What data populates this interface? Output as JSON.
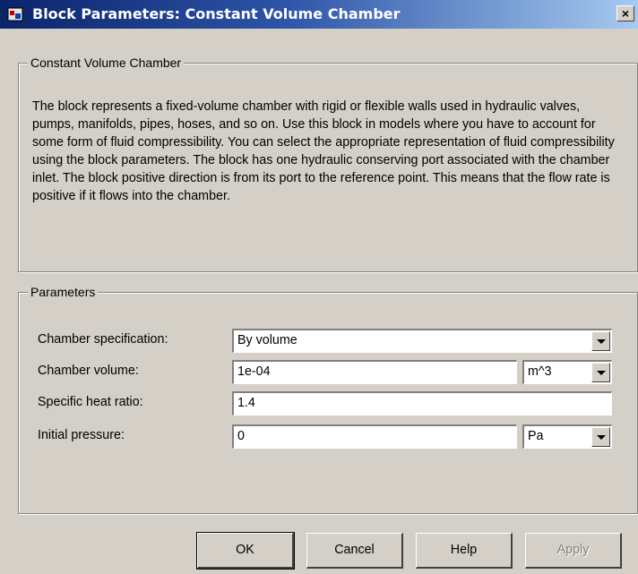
{
  "window": {
    "title": "Block Parameters: Constant Volume Chamber",
    "close_glyph": "×",
    "icon": "block-parameters-icon"
  },
  "description_group": {
    "title": "Constant Volume Chamber",
    "text": "The block represents a fixed-volume chamber with rigid or flexible walls used in hydraulic valves, pumps, manifolds, pipes, hoses, and so on. Use this block in models where you have to account for some form of fluid compressibility. You can select the appropriate representation of fluid compressibility using the block parameters. The block has one hydraulic conserving port associated with the chamber inlet. The block positive direction is from its port to the reference point. This means that the flow rate is positive if it flows into the chamber."
  },
  "parameters_group": {
    "title": "Parameters",
    "rows": [
      {
        "label": "Chamber specification:",
        "value": "By volume"
      },
      {
        "label": "Chamber volume:",
        "value": "1e-04",
        "unit": "m^3"
      },
      {
        "label": "Specific heat ratio:",
        "value": "1.4"
      },
      {
        "label": "Initial pressure:",
        "value": "0",
        "unit": "Pa"
      }
    ]
  },
  "buttons": {
    "ok": "OK",
    "cancel": "Cancel",
    "help": "Help",
    "apply": "Apply"
  },
  "colors": {
    "dialog_background": "#d4d0c8",
    "titlebar_start": "#0a246a",
    "titlebar_end": "#a6caf0",
    "disabled_text": "#808080"
  }
}
